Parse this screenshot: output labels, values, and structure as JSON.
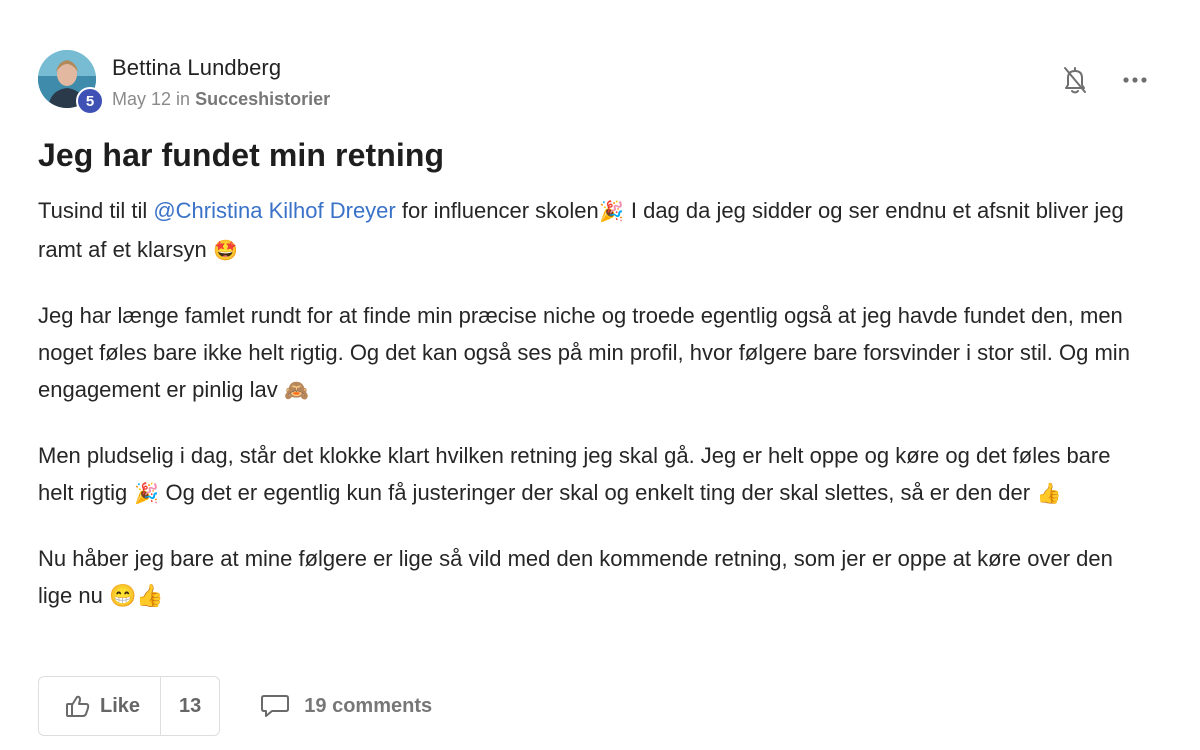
{
  "author": {
    "name": "Bettina Lundberg",
    "level": "5",
    "date": "May 12",
    "in_label": "in",
    "category": "Succeshistorier"
  },
  "post": {
    "title": "Jeg har fundet min retning",
    "paragraphs": {
      "p1": {
        "before_mention": "Tusind til til ",
        "mention": "@Christina Kilhof Dreyer",
        "after_mention": " for influencer skolen",
        "emoji1": "🎉",
        "rest": " I dag da jeg sidder og ser endnu et afsnit bliver jeg ramt af et klarsyn ",
        "emoji2": "🤩"
      },
      "p2": {
        "text": "Jeg har længe famlet rundt for at finde min præcise niche og troede egentlig også at jeg havde fundet den, men noget føles bare ikke helt rigtig. Og det kan også ses på min profil, hvor følgere bare forsvinder i stor stil. Og min engagement er pinlig lav ",
        "emoji": "🙈"
      },
      "p3": {
        "text1": "Men pludselig i dag, står det klokke klart hvilken retning jeg skal gå. Jeg er helt oppe og køre og det føles bare helt rigtig ",
        "emoji1": "🎉",
        "text2": " Og det er egentlig kun få justeringer der skal og enkelt ting der skal slettes, så er den der ",
        "emoji2": "👍"
      },
      "p4": {
        "text": "Nu håber jeg bare at mine følgere er lige så vild med den kommende retning, som jer er oppe at køre over den lige nu ",
        "emoji": "😁👍"
      }
    }
  },
  "footer": {
    "like_label": "Like",
    "like_count": "13",
    "comments_label": "19 comments"
  },
  "icons": {
    "bell": "bell-muted-icon",
    "more": "more-horizontal-icon",
    "like": "thumbs-up-icon",
    "comment": "comment-bubble-icon"
  },
  "colors": {
    "mention": "#3a72c8",
    "level_badge": "#3f51b5"
  }
}
